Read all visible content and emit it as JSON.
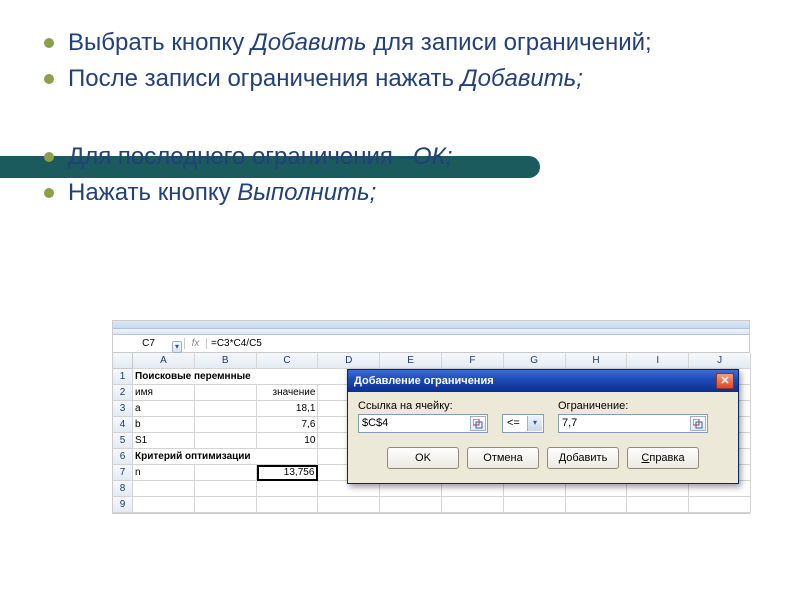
{
  "bullets": {
    "b1a": "Выбрать кнопку ",
    "b1b": "Добавить",
    "b1c": " для записи ограничений;",
    "b2a": "После записи ограничения нажать ",
    "b2b": "Добавить;",
    "b3a": "Для последнего ограничения –",
    "b3b": "ОК;",
    "b4a": "Нажать кнопку ",
    "b4b": "Выполнить;"
  },
  "excel": {
    "cellref": "C7",
    "fx": "fx",
    "formula": "=C3*C4/C5",
    "cols": [
      "A",
      "B",
      "C",
      "D",
      "E",
      "F",
      "G",
      "H",
      "I",
      "J"
    ],
    "row_labels": [
      "1",
      "2",
      "3",
      "4",
      "5",
      "6",
      "7",
      "8",
      "9"
    ],
    "data": {
      "a1": "Поисковые перемнные",
      "a2": "имя",
      "c2": "значение",
      "a3": "a",
      "c3": "18,1",
      "a4": "b",
      "c4": "7,6",
      "a5": "S1",
      "c5": "10",
      "a6": "Критерий оптимизации",
      "a7": "n",
      "c7": "13,756"
    }
  },
  "dialog": {
    "title": "Добавление ограничения",
    "close": "✕",
    "ref_label": "Ссылка на ячейку:",
    "ref_value": "$C$4",
    "op": "<=",
    "lim_label": "Ограничение:",
    "lim_value": "7,7",
    "btn_ok": "OK",
    "btn_cancel": "Отмена",
    "btn_add": "Добавить",
    "btn_help": "Справка"
  }
}
